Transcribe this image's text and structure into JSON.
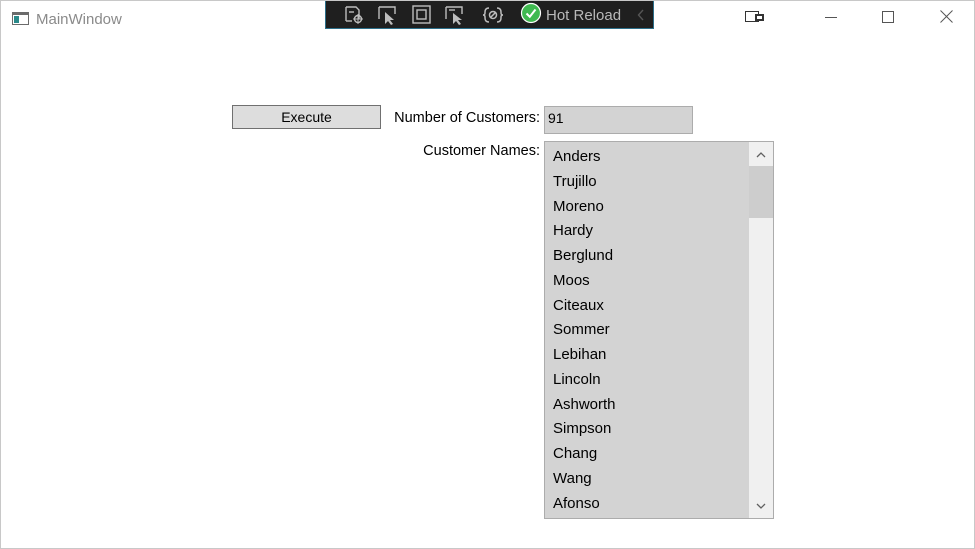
{
  "window": {
    "title": "MainWindow",
    "app_icon": "wpf-window-icon",
    "caption_buttons": [
      "device-window-icon",
      "minimize-icon",
      "maximize-icon",
      "close-icon"
    ]
  },
  "debug_toolbar": {
    "icons": [
      "live-visual-tree-icon",
      "select-element-icon",
      "display-layout-adorners-icon",
      "track-focus-icon",
      "binding-failures-icon"
    ],
    "hot_reload_label": "Hot Reload",
    "hot_reload_icon": "checkmark-circle-icon",
    "collapse_icon": "chevron-left-icon"
  },
  "form": {
    "execute_label": "Execute",
    "count_label": "Number of Customers:",
    "count_value": "91",
    "names_label": "Customer Names:",
    "names": [
      "Anders",
      "Trujillo",
      "Moreno",
      "Hardy",
      "Berglund",
      "Moos",
      "Citeaux",
      "Sommer",
      "Lebihan",
      "Lincoln",
      "Ashworth",
      "Simpson",
      "Chang",
      "Wang",
      "Afonso"
    ]
  },
  "colors": {
    "field_background": "#d3d3d3",
    "button_background": "#dddddd",
    "toolbar_background": "#1f1f1f",
    "hot_reload_check": "#3fb950"
  }
}
